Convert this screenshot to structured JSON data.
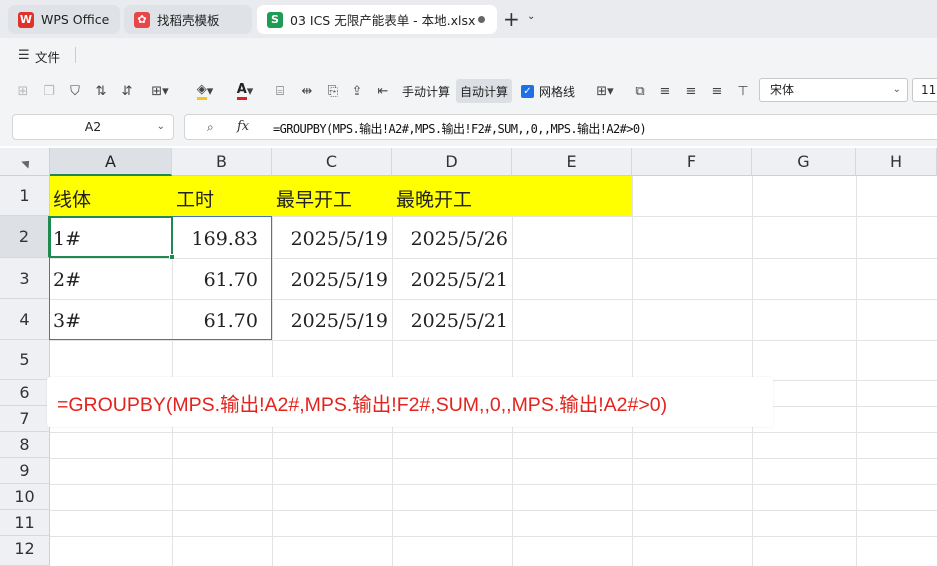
{
  "tabs": [
    {
      "label": "WPS Office",
      "icon": "wps-logo-icon"
    },
    {
      "label": "找稻壳模板",
      "icon": "docer-icon"
    },
    {
      "label": "03 ICS 无限产能表单 - 本地.xlsx",
      "icon": "spreadsheet-icon",
      "icon_text": "S"
    }
  ],
  "menu": {
    "file_label": "文件"
  },
  "toolbar": {
    "manual_calc": "手动计算",
    "auto_calc": "自动计算",
    "gridlines": "网格线",
    "font": "宋体",
    "font_size": "11"
  },
  "formula_bar": {
    "name_box": "A2",
    "fx": "fx",
    "formula": "=GROUPBY(MPS.输出!A2#,MPS.输出!F2#,SUM,,0,,MPS.输出!A2#>0)"
  },
  "columns": [
    "A",
    "B",
    "C",
    "D",
    "E",
    "F",
    "G",
    "H"
  ],
  "rows": [
    "1",
    "2",
    "3",
    "4",
    "5",
    "6",
    "7",
    "8",
    "9",
    "10",
    "11",
    "12"
  ],
  "sheet": {
    "header": [
      "线体",
      "工时",
      "最早开工",
      "最晚开工"
    ],
    "data": [
      [
        "1#",
        "169.83",
        "2025/5/19",
        "2025/5/26"
      ],
      [
        "2#",
        "61.70",
        "2025/5/19",
        "2025/5/21"
      ],
      [
        "3#",
        "61.70",
        "2025/5/19",
        "2025/5/21"
      ]
    ]
  },
  "overlay": {
    "text": "=GROUPBY(MPS.输出!A2#,MPS.输出!F2#,SUM,,0,,MPS.输出!A2#>0)"
  },
  "colors": {
    "accent_green": "#1e8a4f",
    "highlight": "#ffff00",
    "overlay_text": "#e3231d",
    "range_border": "#4472c4"
  }
}
